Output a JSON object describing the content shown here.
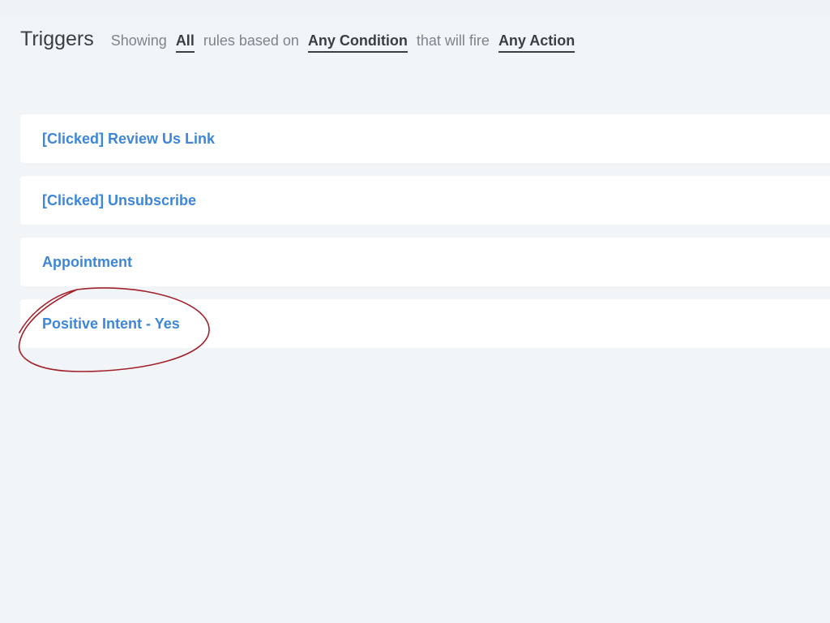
{
  "header": {
    "title": "Triggers",
    "showing_prefix": "Showing",
    "showing_value": "All",
    "condition_prefix": "rules based on",
    "condition_value": "Any Condition",
    "action_prefix": "that will fire",
    "action_value": "Any Action"
  },
  "triggers": [
    {
      "name": "[Clicked] Review Us Link"
    },
    {
      "name": "[Clicked] Unsubscribe"
    },
    {
      "name": "Appointment"
    },
    {
      "name": "Positive Intent - Yes"
    }
  ],
  "colors": {
    "accent": "#3d86d8",
    "annotation": "#a3222c",
    "background": "#f1f5f8"
  }
}
